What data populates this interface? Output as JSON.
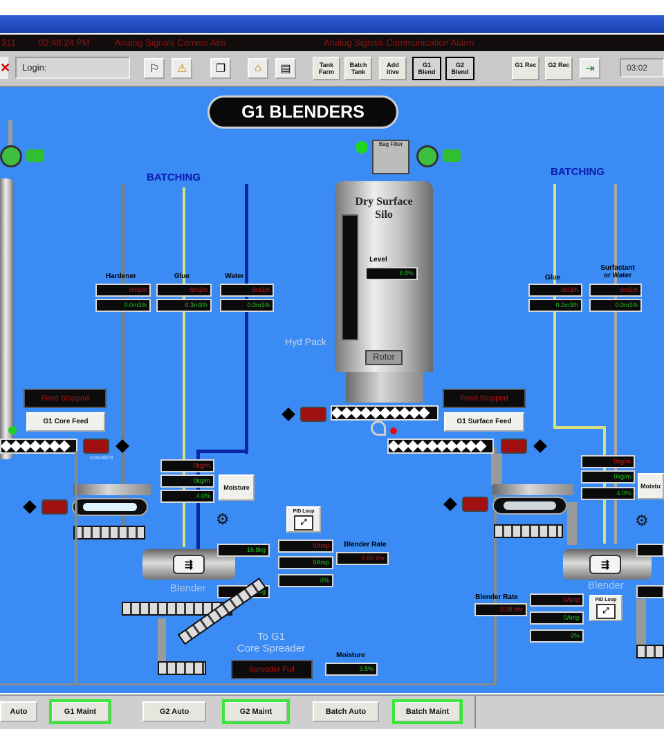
{
  "alarm_bar": {
    "col1": "311",
    "col2": "02:48:24 PM",
    "col3": "Analog Signals Comms Alm",
    "col4": "Analog Signals Communication Alarm"
  },
  "toolbar": {
    "login_label": "Login:",
    "buttons": [
      {
        "label": "Tank Farm"
      },
      {
        "label": "Batch Tank"
      },
      {
        "label": "Add itive"
      },
      {
        "label": "G1 Blend"
      },
      {
        "label": "G2 Blend"
      },
      {
        "label": "G1 Rec"
      },
      {
        "label": "G2 Rec"
      }
    ],
    "clock": "03:02"
  },
  "page_title": "G1 BLENDERS",
  "left": {
    "batching_label": "BATCHING",
    "hardener_label": "Hardener",
    "glue_label": "Glue",
    "water_label": "Water",
    "hardener_values": [
      "0m3/h",
      "0.0m3/h"
    ],
    "glue_values": [
      "0m3/h",
      "0.3m3/h"
    ],
    "water_values": [
      "0m3/h",
      "0.0m3/h"
    ],
    "feed_status": "Feed Stopped",
    "feed_button": "G1 Core Feed",
    "flow_values": [
      "0kg/m",
      "0kg/m",
      "4.0%"
    ],
    "moisture_button": "Moisture",
    "blender_label": "Blender",
    "blender_values": [
      "16.8kg",
      "16.9kg"
    ],
    "amp_values": [
      "0Amp",
      "0Amp",
      "0%"
    ],
    "blender_rate_label": "Blender Rate",
    "blender_rate_value": "0.00 t/hr",
    "pid_label": "PID Loop",
    "to_spreader_label": "To G1\nCore Spreader",
    "spreader_status": "Spreader Full",
    "moisture_label": "Moisture",
    "moisture_value": "3.5%"
  },
  "center": {
    "silo_label": "Dry Surface\nSilo",
    "bag_filter": "Bag Filter",
    "level_label": "Level",
    "level_value": "6.8%",
    "hyd_pack": "Hyd Pack",
    "rotor": "Rotor",
    "feed_status": "Feed Stopped",
    "feed_button": "G1 Surface Feed"
  },
  "right": {
    "batching_label": "BATCHING",
    "glue_label": "Glue",
    "surfactant_label": "Surfactant\nor Water",
    "glue_values": [
      "0m3/h",
      "0.2m3/h"
    ],
    "surfactant_values": [
      "0m3/h",
      "0.0m3/h"
    ],
    "flow_values": [
      "0kg/m",
      "0kg/m",
      "4.0%"
    ],
    "moisture_button": "Moistu",
    "blender_rate_label": "Blender Rate",
    "blender_rate_value": "0.00 t/hr",
    "amp_values": [
      "0Amp",
      "0Amp",
      "0%"
    ],
    "pid_label": "PID Loop",
    "blender_label": "Blender"
  },
  "bottom_bar": {
    "buttons": [
      {
        "label": "Auto"
      },
      {
        "label": "G1 Maint"
      },
      {
        "label": "G2 Auto"
      },
      {
        "label": "G2 Maint"
      },
      {
        "label": "Batch Auto"
      },
      {
        "label": "Batch Maint"
      }
    ]
  },
  "colors": {
    "canvas": "#3b8bf5",
    "active_outline": "#39e639",
    "alarm_text": "#8a1515"
  }
}
